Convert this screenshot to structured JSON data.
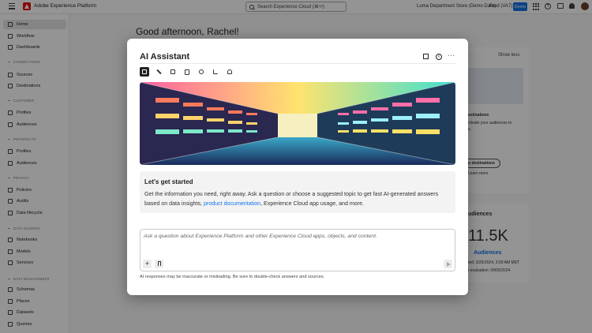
{
  "topbar": {
    "app_name": "Adobe Experience Platform",
    "search_placeholder": "Search Experience Cloud (⌘+/)",
    "org": "Luma Department Store (Demo Data)",
    "sandbox": "Prod (VA7)",
    "badge": "Demo"
  },
  "sidebar": {
    "items": [
      {
        "label": "Home"
      },
      {
        "label": "Workflow"
      },
      {
        "label": "Dashboards"
      },
      {
        "label": "Sources"
      },
      {
        "label": "Destinations"
      },
      {
        "label": "Profiles"
      },
      {
        "label": "Audiences"
      },
      {
        "label": "Profiles"
      },
      {
        "label": "Audiences"
      },
      {
        "label": "Policies"
      },
      {
        "label": "Audits"
      },
      {
        "label": "Data lifecycle"
      },
      {
        "label": "Notebooks"
      },
      {
        "label": "Models"
      },
      {
        "label": "Services"
      },
      {
        "label": "Schemas"
      },
      {
        "label": "Places"
      },
      {
        "label": "Datasets"
      },
      {
        "label": "Queries"
      }
    ],
    "sections": [
      "CONNECTIONS",
      "CUSTOMER",
      "PROSPECTS",
      "PRIVACY",
      "DATA SCIENCE",
      "DATA MANAGEMENT"
    ]
  },
  "main": {
    "greeting": "Good afternoon, Rachel!",
    "show_less": "Show less",
    "dest_title": "estinations",
    "dest_line1": "ctivate your audiences to",
    "dest_line2": "s.",
    "dest_button": "p destinations",
    "learn_more": "Learn more",
    "aud_title": "udiences",
    "aud_count": "11.5K",
    "aud_label": "Audiences",
    "aud_updated": "ted: 3/25/2024, 3:00 AM MDT",
    "aud_eval": "t evaluation: 09/06/2024"
  },
  "modal": {
    "title": "AI Assistant",
    "getstarted_title": "Let's get started",
    "body_before": "Get the information you need, right away. Ask a question or choose a suggested topic to get fast AI-generated answers based on data insights, ",
    "body_link": "product documentation",
    "body_after": ", Experience Cloud app usage, and more.",
    "input_placeholder": "Ask a question about Experience Platform and other Experience Cloud apps, objects, and content.",
    "attach_label": "+",
    "disclaimer": "AI responses may be inaccurate or misleading. Be sure to double-check answers and sources."
  },
  "colors": {
    "accent": "#1473e6",
    "adobe_red": "#eb1000"
  }
}
